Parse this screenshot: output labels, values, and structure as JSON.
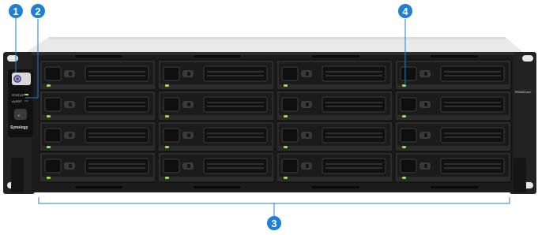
{
  "device": {
    "brand": "Synology",
    "model_label": "RS4021xs+",
    "status_label": "STATUS",
    "alert_label": "ALERT",
    "colors": {
      "chassis": "#1c1c1c",
      "bay": "#2a2a2a",
      "led_green": "#8ee34a",
      "callout_blue": "#1f7fd8"
    }
  },
  "callouts": [
    {
      "number": "1",
      "target": "power-button"
    },
    {
      "number": "2",
      "target": "alert-indicator"
    },
    {
      "number": "3",
      "target": "drive-trays"
    },
    {
      "number": "4",
      "target": "drive-status-indicator"
    }
  ],
  "drive_bays": {
    "rows": 4,
    "columns": 4
  },
  "icons": {
    "power": "power-icon",
    "beep_off": "beep-off-icon"
  }
}
